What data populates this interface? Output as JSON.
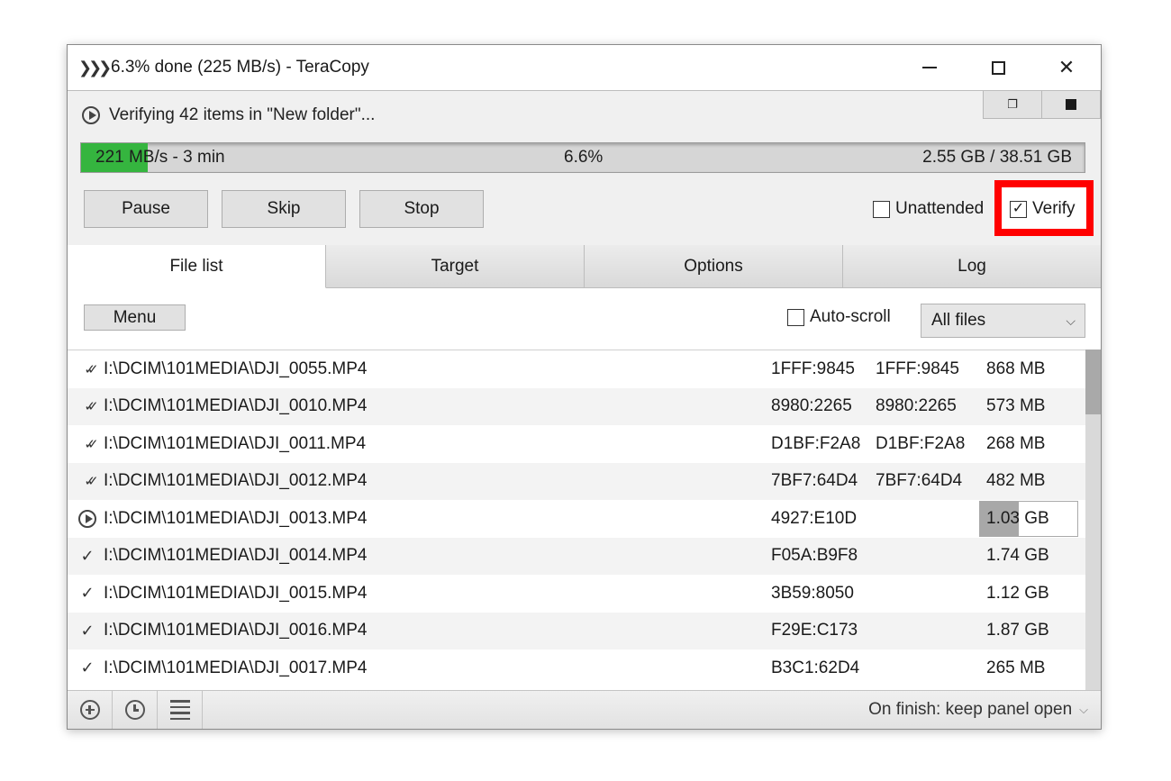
{
  "window": {
    "title": "6.3% done (225 MB/s) - TeraCopy",
    "title_icon": "triple-chevron-icon",
    "controls": {
      "minimize": "minimize",
      "maximize": "maximize",
      "close": "close"
    },
    "mini_buttons": [
      "restore-panel",
      "stop-square"
    ]
  },
  "status": {
    "text": "Verifying 42 items in \"New folder\"..."
  },
  "progress": {
    "fraction": 0.066,
    "left_text": "221 MB/s - 3 min",
    "center_text": "6.6%",
    "right_text": "2.55 GB / 38.51 GB",
    "fill_color": "#35b53f"
  },
  "buttons": {
    "pause": "Pause",
    "skip": "Skip",
    "stop": "Stop"
  },
  "options": {
    "unattended": {
      "label": "Unattended",
      "checked": false
    },
    "verify": {
      "label": "Verify",
      "checked": true,
      "highlight_color": "#ff0000"
    }
  },
  "tabs": [
    {
      "label": "File list",
      "active": true
    },
    {
      "label": "Target",
      "active": false
    },
    {
      "label": "Options",
      "active": false
    },
    {
      "label": "Log",
      "active": false
    }
  ],
  "filelist": {
    "menu_label": "Menu",
    "autoscroll": {
      "label": "Auto-scroll",
      "checked": false
    },
    "filter": {
      "selected": "All files"
    },
    "rows": [
      {
        "status": "verified",
        "path": "I:\\DCIM\\101MEDIA\\DJI_0055.MP4",
        "src_hash": "1FFF:9845",
        "dst_hash": "1FFF:9845",
        "size": "868 MB"
      },
      {
        "status": "verified",
        "path": "I:\\DCIM\\101MEDIA\\DJI_0010.MP4",
        "src_hash": "8980:2265",
        "dst_hash": "8980:2265",
        "size": "573 MB"
      },
      {
        "status": "verified",
        "path": "I:\\DCIM\\101MEDIA\\DJI_0011.MP4",
        "src_hash": "D1BF:F2A8",
        "dst_hash": "D1BF:F2A8",
        "size": "268 MB"
      },
      {
        "status": "verified",
        "path": "I:\\DCIM\\101MEDIA\\DJI_0012.MP4",
        "src_hash": "7BF7:64D4",
        "dst_hash": "7BF7:64D4",
        "size": "482 MB"
      },
      {
        "status": "in-progress",
        "path": "I:\\DCIM\\101MEDIA\\DJI_0013.MP4",
        "src_hash": "4927:E10D",
        "dst_hash": "",
        "size": "1.03 GB",
        "progress": 0.4
      },
      {
        "status": "copied",
        "path": "I:\\DCIM\\101MEDIA\\DJI_0014.MP4",
        "src_hash": "F05A:B9F8",
        "dst_hash": "",
        "size": "1.74 GB"
      },
      {
        "status": "copied",
        "path": "I:\\DCIM\\101MEDIA\\DJI_0015.MP4",
        "src_hash": "3B59:8050",
        "dst_hash": "",
        "size": "1.12 GB"
      },
      {
        "status": "copied",
        "path": "I:\\DCIM\\101MEDIA\\DJI_0016.MP4",
        "src_hash": "F29E:C173",
        "dst_hash": "",
        "size": "1.87 GB"
      },
      {
        "status": "copied",
        "path": "I:\\DCIM\\101MEDIA\\DJI_0017.MP4",
        "src_hash": "B3C1:62D4",
        "dst_hash": "",
        "size": "265 MB"
      }
    ]
  },
  "bottombar": {
    "icons": [
      "add-icon",
      "history-icon",
      "list-icon"
    ],
    "on_finish": "On finish: keep panel open"
  }
}
